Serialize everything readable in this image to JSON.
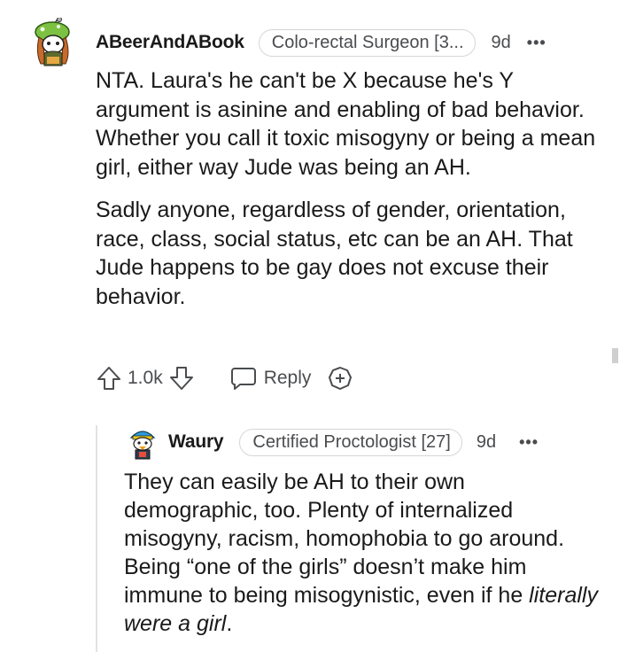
{
  "comment": {
    "username": "ABeerAndABook",
    "flair": "Colo-rectal Surgeon [3...",
    "time": "9d",
    "more_label": "•••",
    "paragraphs": [
      "NTA. Laura's he can't be X because he's Y argument is asinine and enabling of bad behavior. Whether you call it toxic misogyny or being a mean girl, either way Jude was being an AH.",
      "Sadly anyone, regardless of gender, orientation, race, class, social status, etc can be an AH. That Jude happens to be gay does not excuse their behavior."
    ],
    "votes": "1.0k",
    "reply_label": "Reply",
    "icons": {
      "upvote": "upvote-arrow-icon",
      "downvote": "downvote-arrow-icon",
      "reply": "speech-bubble-icon",
      "award": "award-plus-icon",
      "avatar": "snoo-avatar-green-hat"
    }
  },
  "reply": {
    "username": "Waury",
    "flair": "Certified Proctologist [27]",
    "time": "9d",
    "more_label": "•••",
    "body_main": "They can easily be AH to their own demographic, too. Plenty of internalized misogyny, racism, homophobia to go around. Being “one of the girls” doesn’t make him immune to being misogynistic, even if he ",
    "body_italic": "literally were a girl",
    "body_end": ".",
    "icons": {
      "avatar": "snoo-avatar-duck-hat"
    }
  },
  "colors": {
    "text": "#1a1a1b",
    "meta": "#4a4c4f",
    "border": "#d4d6d8",
    "thread_line": "#e2e3e5"
  }
}
